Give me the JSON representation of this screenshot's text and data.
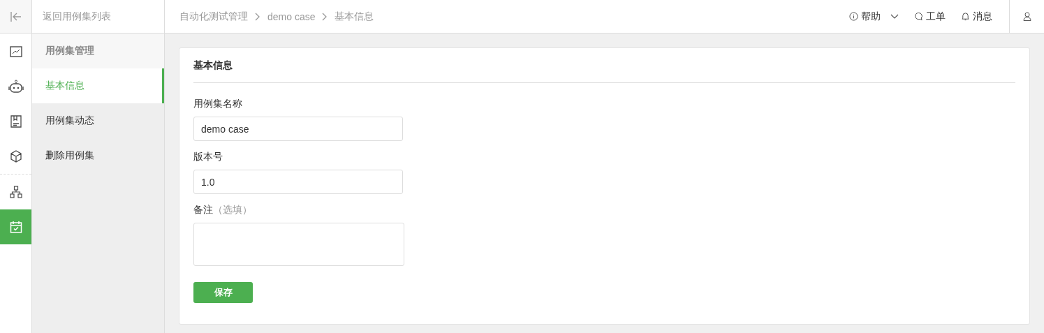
{
  "back_link": "返回用例集列表",
  "breadcrumb": [
    "自动化测试管理",
    "demo case",
    "基本信息"
  ],
  "header_actions": [
    {
      "kind": "info",
      "label": "帮助",
      "dropdown": true
    },
    {
      "kind": "chat",
      "label": "工单",
      "dropdown": false
    },
    {
      "kind": "bell",
      "label": "消息",
      "dropdown": false
    }
  ],
  "rail": {
    "groups": [
      [
        {
          "kind": "chart",
          "selected": false
        },
        {
          "kind": "robot",
          "selected": false
        },
        {
          "kind": "doc",
          "selected": false
        },
        {
          "kind": "cube",
          "selected": false
        }
      ],
      [
        {
          "kind": "network",
          "selected": false
        },
        {
          "kind": "calendar",
          "selected": true
        }
      ]
    ]
  },
  "submenu": {
    "heading": "用例集管理",
    "items": [
      {
        "label": "基本信息",
        "selected": true
      },
      {
        "label": "用例集动态",
        "selected": false
      },
      {
        "label": "删除用例集",
        "selected": false
      }
    ]
  },
  "card": {
    "title": "基本信息",
    "fields": [
      {
        "kind": "input",
        "label": "用例集名称",
        "value": "demo case"
      },
      {
        "kind": "input",
        "label": "版本号",
        "value": "1.0"
      },
      {
        "kind": "textarea",
        "label": "备注",
        "hint": "（选填）"
      }
    ],
    "save_button": "保存"
  }
}
